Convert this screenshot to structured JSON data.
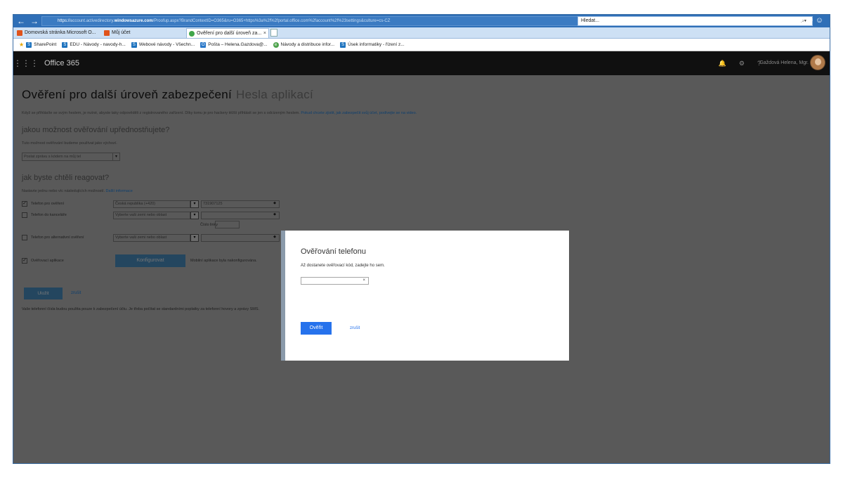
{
  "browser": {
    "url_scheme": "https://",
    "url_pre_host": "account.activedirectory.",
    "url_host": "windowsazure.com",
    "url_rest": "/Proofup.aspx?BrandContextID=O365&ru=O365+https%3a%2f%2fportal.office.com%2faccount%2f%23settings&culture=cs-CZ",
    "search_placeholder": "Hledat...",
    "tabs": [
      {
        "label": "Domovská stránka Microsoft O..."
      },
      {
        "label": "Můj účet"
      },
      {
        "label": "Ověření pro další úroveň za...",
        "close": "×"
      }
    ],
    "favorites": [
      {
        "label": "SharePoint"
      },
      {
        "label": "EDU - Návody - navody-h..."
      },
      {
        "label": "Webové návody - Všechn..."
      },
      {
        "label": "Pošta – Helena.Gazdova@..."
      },
      {
        "label": "Návody a distribuce infor..."
      },
      {
        "label": "Úsek informatiky - řízení z..."
      }
    ]
  },
  "o365": {
    "title": "Office 365",
    "user_name": "Gaždová Helena, Mgr."
  },
  "page": {
    "title": "Ověření pro další úroveň zabezpečení",
    "title_tab": "Hesla aplikací",
    "intro": "Když se přihlásíte se svým heslem, je nutné, abyste taky odpověděli z registrovaného zařízení. Díky tomu je pro hackery těžší přihlásit se jen s odcizeným heslem.",
    "intro_link": "Pokud chcete zjistit, jak zabezpečit svůj účet, podívejte se na video.",
    "pref_heading": "jakou možnost ověřování upřednostňujete?",
    "pref_desc": "Tuto možnost ověřování budeme používat jako výchozí.",
    "pref_value": "Poslat zprávu s kódem na můj tel",
    "respond_heading": "jak byste chtěli reagovat?",
    "respond_desc": "Nastavte jednu nebo víc následujících možností.",
    "respond_link": "Další informace",
    "options": {
      "auth_phone_label": "Telefon pro ověření",
      "auth_phone_country": "Česká republika (+420)",
      "auth_phone_number": "731907125",
      "office_phone_label": "Telefon do kanceláře",
      "office_phone_country": "Vyberte vaši zemi nebo oblast",
      "extension_label": "Číslo linky",
      "alt_phone_label": "Telefon pro alternativní ověření",
      "alt_phone_country": "Vyberte vaši zemi nebo oblast",
      "app_label": "Ověřovací aplikace",
      "configure_button": "Konfigurovat",
      "app_note": "Mobilní aplikace byla nakonfigurována."
    },
    "save_button": "Uložit",
    "cancel_link": "zrušit",
    "footer": "Vaše telefonní čísla budou použita pouze k zabezpečení účtu. Je třeba počítat se standardními poplatky za telefonní hovory a zprávy SMS."
  },
  "dialog": {
    "title": "Ověřování telefonu",
    "desc": "Až dostanete ověřovací kód, zadejte ho sem.",
    "clear": "×",
    "verify_button": "Ověřit",
    "cancel": "zrušit"
  }
}
